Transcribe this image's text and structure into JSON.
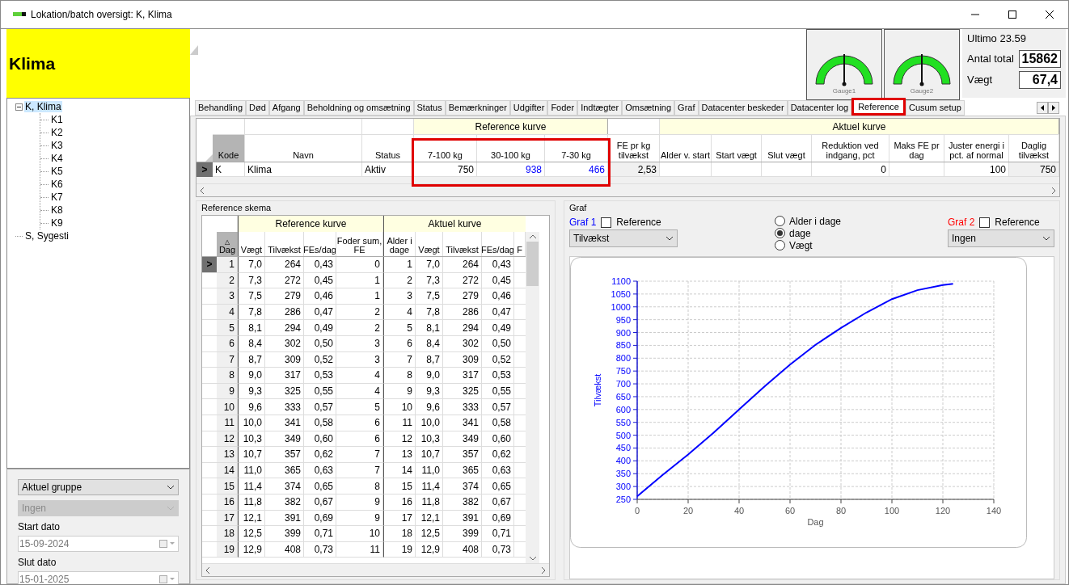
{
  "window": {
    "title": "Lokation/batch oversigt: K, Klima"
  },
  "header": {
    "name": "Klima",
    "gauges": [
      {
        "label": "Gauge1"
      },
      {
        "label": "Gauge2"
      }
    ],
    "summary": {
      "title": "Ultimo 23.59",
      "fields": [
        {
          "label": "Antal total",
          "value": "15862"
        },
        {
          "label": "Vægt",
          "value": "67,4"
        }
      ]
    }
  },
  "tree": [
    {
      "label": "K, Klima",
      "selected": true,
      "expanded": true,
      "children": [
        {
          "label": "K1",
          "selected": false
        },
        {
          "label": "K2",
          "selected": false
        },
        {
          "label": "K3",
          "selected": false
        },
        {
          "label": "K4",
          "selected": false
        },
        {
          "label": "K5",
          "selected": false
        },
        {
          "label": "K6",
          "selected": false
        },
        {
          "label": "K7",
          "selected": false
        },
        {
          "label": "K8",
          "selected": false
        },
        {
          "label": "K9",
          "selected": false
        }
      ]
    },
    {
      "label": "S, Sygesti",
      "selected": false
    }
  ],
  "filters": {
    "group_select": {
      "value": "Aktuel gruppe",
      "disabled": false
    },
    "sub_select": {
      "value": "Ingen",
      "disabled": true
    },
    "start_label": "Start dato",
    "start_value": "15-09-2024",
    "end_label": "Slut dato",
    "end_value": "15-01-2025"
  },
  "tabs": [
    {
      "label": "Behandling",
      "selected": false
    },
    {
      "label": "Død",
      "selected": false
    },
    {
      "label": "Afgang",
      "selected": false
    },
    {
      "label": "Beholdning og omsætning",
      "selected": false
    },
    {
      "label": "Status",
      "selected": false
    },
    {
      "label": "Bemærkninger",
      "selected": false
    },
    {
      "label": "Udgifter",
      "selected": false
    },
    {
      "label": "Foder",
      "selected": false
    },
    {
      "label": "Indtægter",
      "selected": false
    },
    {
      "label": "Omsætning",
      "selected": false
    },
    {
      "label": "Graf",
      "selected": false
    },
    {
      "label": "Datacenter beskeder",
      "selected": false
    },
    {
      "label": "Datacenter log",
      "selected": false
    },
    {
      "label": "Reference",
      "selected": true
    },
    {
      "label": "Cusum setup",
      "selected": false
    }
  ],
  "top_grid": {
    "groups": [
      {
        "label": "Reference kurve"
      },
      {
        "label": "Aktuel kurve"
      }
    ],
    "columns": [
      {
        "label": "Kode",
        "highlighted": false
      },
      {
        "label": "Navn",
        "highlighted": false
      },
      {
        "label": "Status",
        "highlighted": false
      },
      {
        "label": "7-100 kg",
        "highlighted": true
      },
      {
        "label": "30-100 kg",
        "highlighted": true
      },
      {
        "label": "7-30 kg",
        "highlighted": true
      },
      {
        "label": "FE pr kg tilvækst",
        "highlighted": false
      },
      {
        "label": "Alder v. start",
        "highlighted": false
      },
      {
        "label": "Start vægt",
        "highlighted": false
      },
      {
        "label": "Slut vægt",
        "highlighted": false
      },
      {
        "label": "Reduktion ved indgang, pct",
        "highlighted": false
      },
      {
        "label": "Maks FE pr dag",
        "highlighted": false
      },
      {
        "label": "Juster energi i pct. af normal",
        "highlighted": false
      },
      {
        "label": "Daglig tilvækst",
        "highlighted": false
      }
    ],
    "row_indicator": ">",
    "rows": [
      {
        "selected": true,
        "cells": [
          {
            "text": "K",
            "kind": "plain"
          },
          {
            "text": "Klima",
            "kind": "plain"
          },
          {
            "text": "Aktiv",
            "kind": "plain"
          },
          {
            "text": "750",
            "kind": "plain"
          },
          {
            "text": "938",
            "kind": "computed"
          },
          {
            "text": "466",
            "kind": "computed"
          },
          {
            "text": "2,53",
            "kind": "readonly"
          },
          null,
          null,
          null,
          {
            "text": "0",
            "kind": "plain"
          },
          null,
          {
            "text": "100",
            "kind": "plain"
          },
          {
            "text": "750",
            "kind": "readonly"
          }
        ]
      }
    ]
  },
  "reference_schema": {
    "title": "Reference skema",
    "groups": [
      {
        "label": "Reference kurve"
      },
      {
        "label": "Aktuel kurve"
      }
    ],
    "columns": [
      "Dag",
      "Vægt",
      "Tilvækst",
      "FEs/dag",
      "Foder sum, FE",
      "Alder i dage",
      "Vægt",
      "Tilvækst",
      "FEs/dag",
      "F"
    ],
    "sort_marker": "△",
    "row_indicator": ">",
    "rows": [
      {
        "selected": true,
        "cells": [
          "1",
          "7,0",
          "264",
          "0,43",
          "0",
          "1",
          "7,0",
          "264",
          "0,43"
        ]
      },
      {
        "selected": false,
        "cells": [
          "2",
          "7,3",
          "272",
          "0,45",
          "1",
          "2",
          "7,3",
          "272",
          "0,45"
        ]
      },
      {
        "selected": false,
        "cells": [
          "3",
          "7,5",
          "279",
          "0,46",
          "1",
          "3",
          "7,5",
          "279",
          "0,46"
        ]
      },
      {
        "selected": false,
        "cells": [
          "4",
          "7,8",
          "286",
          "0,47",
          "2",
          "4",
          "7,8",
          "286",
          "0,47"
        ]
      },
      {
        "selected": false,
        "cells": [
          "5",
          "8,1",
          "294",
          "0,49",
          "2",
          "5",
          "8,1",
          "294",
          "0,49"
        ]
      },
      {
        "selected": false,
        "cells": [
          "6",
          "8,4",
          "302",
          "0,50",
          "3",
          "6",
          "8,4",
          "302",
          "0,50"
        ]
      },
      {
        "selected": false,
        "cells": [
          "7",
          "8,7",
          "309",
          "0,52",
          "3",
          "7",
          "8,7",
          "309",
          "0,52"
        ]
      },
      {
        "selected": false,
        "cells": [
          "8",
          "9,0",
          "317",
          "0,53",
          "4",
          "8",
          "9,0",
          "317",
          "0,53"
        ]
      },
      {
        "selected": false,
        "cells": [
          "9",
          "9,3",
          "325",
          "0,55",
          "4",
          "9",
          "9,3",
          "325",
          "0,55"
        ]
      },
      {
        "selected": false,
        "cells": [
          "10",
          "9,6",
          "333",
          "0,57",
          "5",
          "10",
          "9,6",
          "333",
          "0,57"
        ]
      },
      {
        "selected": false,
        "cells": [
          "11",
          "10,0",
          "341",
          "0,58",
          "6",
          "11",
          "10,0",
          "341",
          "0,58"
        ]
      },
      {
        "selected": false,
        "cells": [
          "12",
          "10,3",
          "349",
          "0,60",
          "6",
          "12",
          "10,3",
          "349",
          "0,60"
        ]
      },
      {
        "selected": false,
        "cells": [
          "13",
          "10,7",
          "357",
          "0,62",
          "7",
          "13",
          "10,7",
          "357",
          "0,62"
        ]
      },
      {
        "selected": false,
        "cells": [
          "14",
          "11,0",
          "365",
          "0,63",
          "7",
          "14",
          "11,0",
          "365",
          "0,63"
        ]
      },
      {
        "selected": false,
        "cells": [
          "15",
          "11,4",
          "374",
          "0,65",
          "8",
          "15",
          "11,4",
          "374",
          "0,65"
        ]
      },
      {
        "selected": false,
        "cells": [
          "16",
          "11,8",
          "382",
          "0,67",
          "9",
          "16",
          "11,8",
          "382",
          "0,67"
        ]
      },
      {
        "selected": false,
        "cells": [
          "17",
          "12,1",
          "391",
          "0,69",
          "9",
          "17",
          "12,1",
          "391",
          "0,69"
        ]
      },
      {
        "selected": false,
        "cells": [
          "18",
          "12,5",
          "399",
          "0,71",
          "10",
          "18",
          "12,5",
          "399",
          "0,71"
        ]
      },
      {
        "selected": false,
        "cells": [
          "19",
          "12,9",
          "408",
          "0,73",
          "11",
          "19",
          "12,9",
          "408",
          "0,73"
        ]
      }
    ]
  },
  "graph": {
    "title": "Graf",
    "graph1": {
      "label": "Graf 1",
      "color": "#0000ff",
      "reference_label": "Reference",
      "reference_checked": false,
      "value": "Tilvækst"
    },
    "axis_options": [
      {
        "label": "Alder i dage",
        "selected": false
      },
      {
        "label": "dage",
        "selected": true
      },
      {
        "label": "Vægt",
        "selected": false
      }
    ],
    "graph2": {
      "label": "Graf 2",
      "color": "#ff0000",
      "reference_label": "Reference",
      "reference_checked": false,
      "value": "Ingen"
    },
    "chart_data": {
      "type": "line",
      "xlabel": "Dag",
      "ylabel": "Tilvækst",
      "x": [
        0,
        10,
        20,
        30,
        40,
        50,
        60,
        70,
        80,
        90,
        100,
        110,
        120,
        124
      ],
      "grid": true,
      "series": [
        {
          "color": "#0000ff",
          "values": [
            262,
            345,
            425,
            510,
            600,
            690,
            775,
            852,
            918,
            978,
            1030,
            1065,
            1085,
            1090
          ]
        }
      ],
      "xlim": [
        0,
        140
      ],
      "ylim": [
        250,
        1100
      ],
      "xticks": [
        0,
        20,
        40,
        60,
        80,
        100,
        120,
        140
      ],
      "yticks": [
        250,
        300,
        350,
        400,
        450,
        500,
        550,
        600,
        650,
        700,
        750,
        800,
        850,
        900,
        950,
        1000,
        1050,
        1100
      ]
    }
  }
}
